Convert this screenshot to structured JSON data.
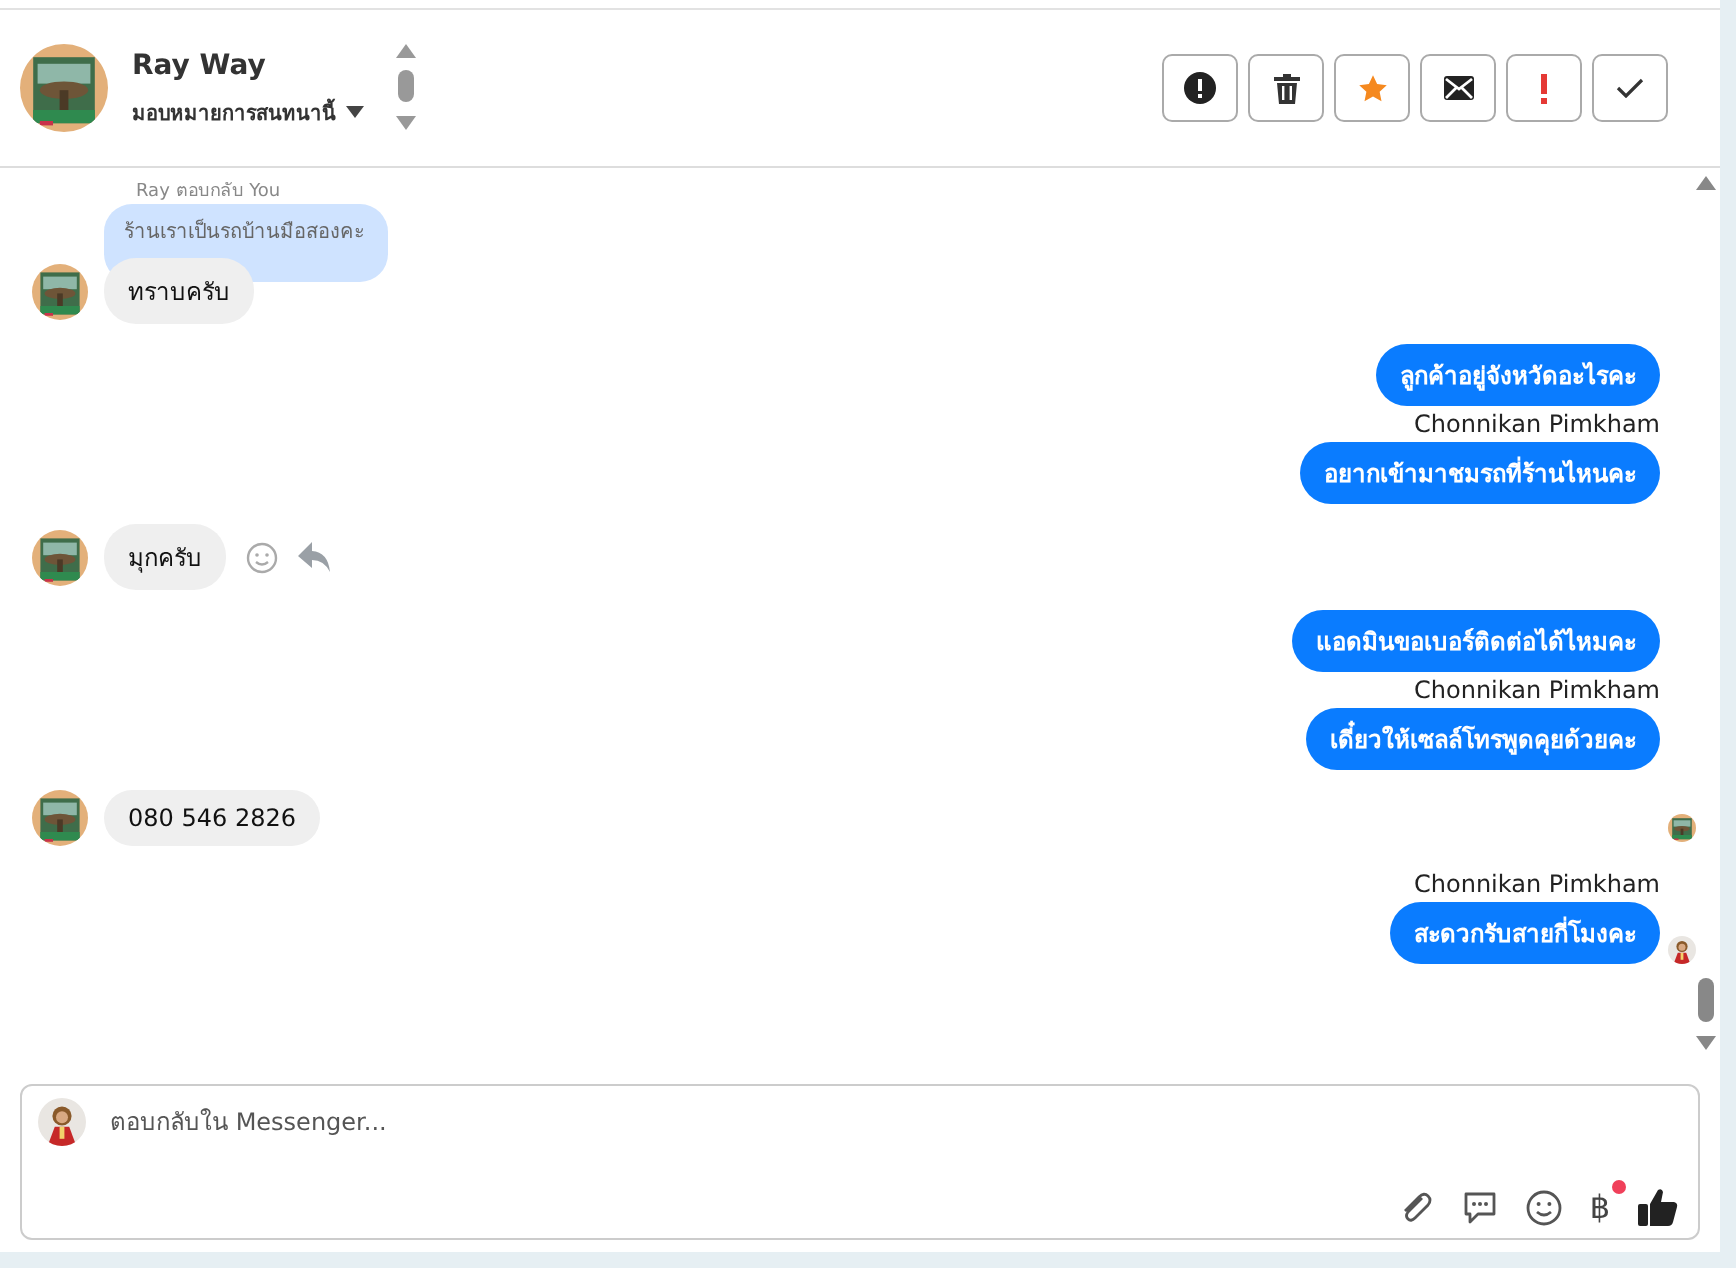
{
  "header": {
    "name": "Ray Way",
    "assign_label": "มอบหมายการสนทนานี้"
  },
  "toolbar": [
    {
      "kind": "spam"
    },
    {
      "kind": "delete"
    },
    {
      "kind": "star"
    },
    {
      "kind": "unread"
    },
    {
      "kind": "important"
    },
    {
      "kind": "done"
    }
  ],
  "messages": [
    {
      "kind": "incoming",
      "text": "ทราบครับ",
      "reply_label": "Ray ตอบกลับ You",
      "quote": "ร้านเราเป็นรถบ้านมือสองคะ",
      "actions": false
    },
    {
      "kind": "outgoing",
      "text": "ลูกค้าอยู่จังหวัดอะไรคะ",
      "read": false
    },
    {
      "kind": "sender",
      "text": "Chonnikan Pimkham"
    },
    {
      "kind": "outgoing",
      "text": "อยากเข้ามาชมรถที่ร้านไหนคะ",
      "read": false
    },
    {
      "kind": "incoming",
      "text": "มุกครับ",
      "actions": true
    },
    {
      "kind": "outgoing",
      "text": "แอดมินขอเบอร์ติดต่อได้ไหมคะ",
      "read": false
    },
    {
      "kind": "sender",
      "text": "Chonnikan Pimkham"
    },
    {
      "kind": "outgoing",
      "text": "เดี๋ยวให้เซลล์โทรพูดคุยด้วยคะ",
      "read": false
    },
    {
      "kind": "incoming",
      "text": "080 546 2826",
      "actions": false
    },
    {
      "kind": "seen"
    },
    {
      "kind": "sender",
      "text": "Chonnikan Pimkham"
    },
    {
      "kind": "outgoing",
      "text": "สะดวกรับสายกี่โมงคะ",
      "read": true
    }
  ],
  "composer": {
    "placeholder": "ตอบกลับใน Messenger...",
    "currency_symbol": "฿",
    "currency_dot": true
  }
}
